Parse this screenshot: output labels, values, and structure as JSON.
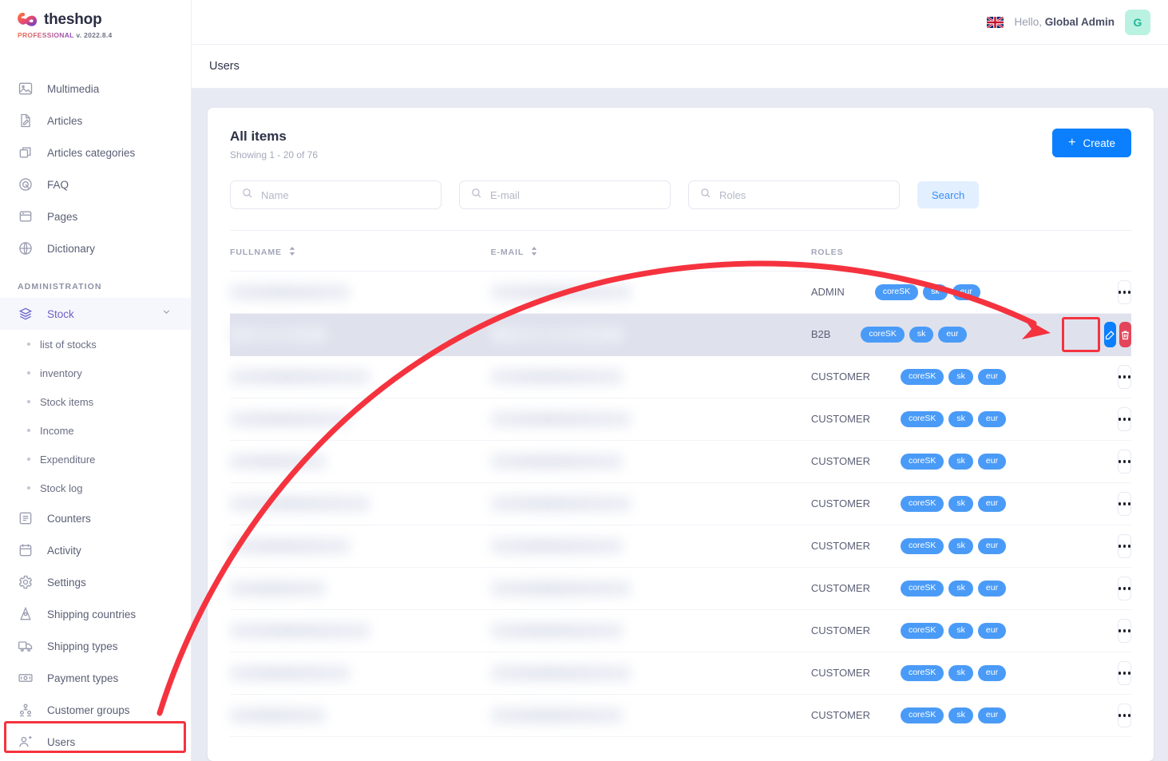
{
  "brand": {
    "name": "theshop",
    "edition": "PROFESSIONAL",
    "version": "v. 2022.8.4",
    "gradient_from": "#f26b4e",
    "gradient_to": "#8b4bbf"
  },
  "topbar": {
    "greeting_prefix": "Hello,",
    "user_name": "Global Admin",
    "avatar_initial": "G",
    "language_flag": "uk-flag-icon"
  },
  "page": {
    "title": "Users"
  },
  "sidebar": {
    "items": [
      {
        "label": "Multimedia",
        "icon": "image-icon"
      },
      {
        "label": "Articles",
        "icon": "article-pencil-icon"
      },
      {
        "label": "Articles categories",
        "icon": "layers-icon"
      },
      {
        "label": "FAQ",
        "icon": "target-circle-icon"
      },
      {
        "label": "Pages",
        "icon": "window-icon"
      },
      {
        "label": "Dictionary",
        "icon": "globe-icon"
      }
    ],
    "section_label": "ADMINISTRATION",
    "admin_items": [
      {
        "label": "Stock",
        "icon": "stack-icon",
        "active": true,
        "expandable": true
      },
      {
        "label": "Counters",
        "icon": "list-icon"
      },
      {
        "label": "Activity",
        "icon": "calendar-icon"
      },
      {
        "label": "Settings",
        "icon": "gear-icon"
      },
      {
        "label": "Shipping countries",
        "icon": "map-pin-icon"
      },
      {
        "label": "Shipping types",
        "icon": "truck-icon"
      },
      {
        "label": "Payment types",
        "icon": "banknote-icon"
      },
      {
        "label": "Customer groups",
        "icon": "users-group-icon"
      },
      {
        "label": "Users",
        "icon": "user-add-icon",
        "highlighted": true
      }
    ],
    "stock_sub_items": [
      {
        "label": "list of stocks"
      },
      {
        "label": "inventory"
      },
      {
        "label": "Stock items"
      },
      {
        "label": "Income"
      },
      {
        "label": "Expenditure"
      },
      {
        "label": "Stock log"
      }
    ]
  },
  "card": {
    "heading": "All items",
    "showing": "Showing 1 - 20 of 76",
    "create_label": "Create",
    "search_label": "Search",
    "filters": [
      {
        "placeholder": "Name",
        "value": "",
        "name": "name"
      },
      {
        "placeholder": "E-mail",
        "value": "",
        "name": "email"
      },
      {
        "placeholder": "Roles",
        "value": "",
        "name": "roles"
      }
    ]
  },
  "table": {
    "columns": [
      {
        "label": "FULLNAME",
        "sortable": true
      },
      {
        "label": "E-MAIL",
        "sortable": true
      },
      {
        "label": "ROLES",
        "sortable": false
      },
      {
        "label": "",
        "sortable": false
      }
    ],
    "rows": [
      {
        "fullname": "",
        "email": "",
        "role": "ADMIN",
        "badges": [
          "coreSK",
          "sk",
          "eur"
        ],
        "selected": false
      },
      {
        "fullname": "",
        "email": "",
        "role": "B2B",
        "badges": [
          "coreSK",
          "sk",
          "eur"
        ],
        "selected": true
      },
      {
        "fullname": "",
        "email": "",
        "role": "CUSTOMER",
        "badges": [
          "coreSK",
          "sk",
          "eur"
        ],
        "selected": false
      },
      {
        "fullname": "",
        "email": "",
        "role": "CUSTOMER",
        "badges": [
          "coreSK",
          "sk",
          "eur"
        ],
        "selected": false
      },
      {
        "fullname": "",
        "email": "",
        "role": "CUSTOMER",
        "badges": [
          "coreSK",
          "sk",
          "eur"
        ],
        "selected": false
      },
      {
        "fullname": "",
        "email": "",
        "role": "CUSTOMER",
        "badges": [
          "coreSK",
          "sk",
          "eur"
        ],
        "selected": false
      },
      {
        "fullname": "",
        "email": "",
        "role": "CUSTOMER",
        "badges": [
          "coreSK",
          "sk",
          "eur"
        ],
        "selected": false
      },
      {
        "fullname": "",
        "email": "",
        "role": "CUSTOMER",
        "badges": [
          "coreSK",
          "sk",
          "eur"
        ],
        "selected": false
      },
      {
        "fullname": "",
        "email": "",
        "role": "CUSTOMER",
        "badges": [
          "coreSK",
          "sk",
          "eur"
        ],
        "selected": false
      },
      {
        "fullname": "",
        "email": "",
        "role": "CUSTOMER",
        "badges": [
          "coreSK",
          "sk",
          "eur"
        ],
        "selected": false
      },
      {
        "fullname": "",
        "email": "",
        "role": "CUSTOMER",
        "badges": [
          "coreSK",
          "sk",
          "eur"
        ],
        "selected": false
      }
    ]
  },
  "annotation": {
    "color": "#f5333f",
    "arrow_from": "sidebar-item-users",
    "arrow_to": "row-edit-button"
  },
  "colors": {
    "primary_blue": "#0b7ffd",
    "badge_blue": "#4a9bf7",
    "danger_red": "#e3465a",
    "page_bg": "#e8eaf3",
    "row_selected": "#dfe2ed",
    "avatar_bg": "#b9f2e1"
  }
}
